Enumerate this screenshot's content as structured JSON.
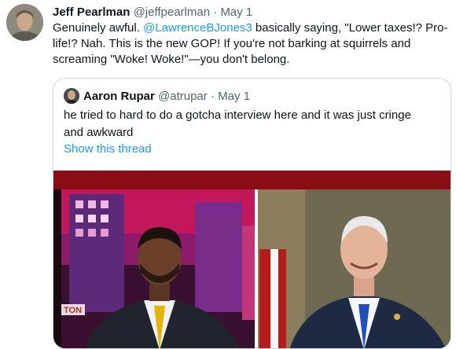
{
  "tweet": {
    "author_name": "Jeff Pearlman",
    "author_handle": "@jeffpearlman",
    "separator": "·",
    "date": "May 1",
    "text_before": "Genuinely awful. ",
    "mention": "@LawrenceBJones3",
    "text_after": " basically saying, \"Lower taxes!? Pro-life!? Nah. This is the new GOP! If you're not barking at squirrels and screaming \"Woke! Woke!\"—you don't belong."
  },
  "quote": {
    "author_name": "Aaron Rupar",
    "author_handle": "@atrupar",
    "separator": "·",
    "date": "May 1",
    "text": "he tried to hard to do a gotcha interview here and it was just cringe and awkward",
    "thread_link": "Show this thread"
  },
  "media": {
    "chyron_fragment": "TON"
  }
}
